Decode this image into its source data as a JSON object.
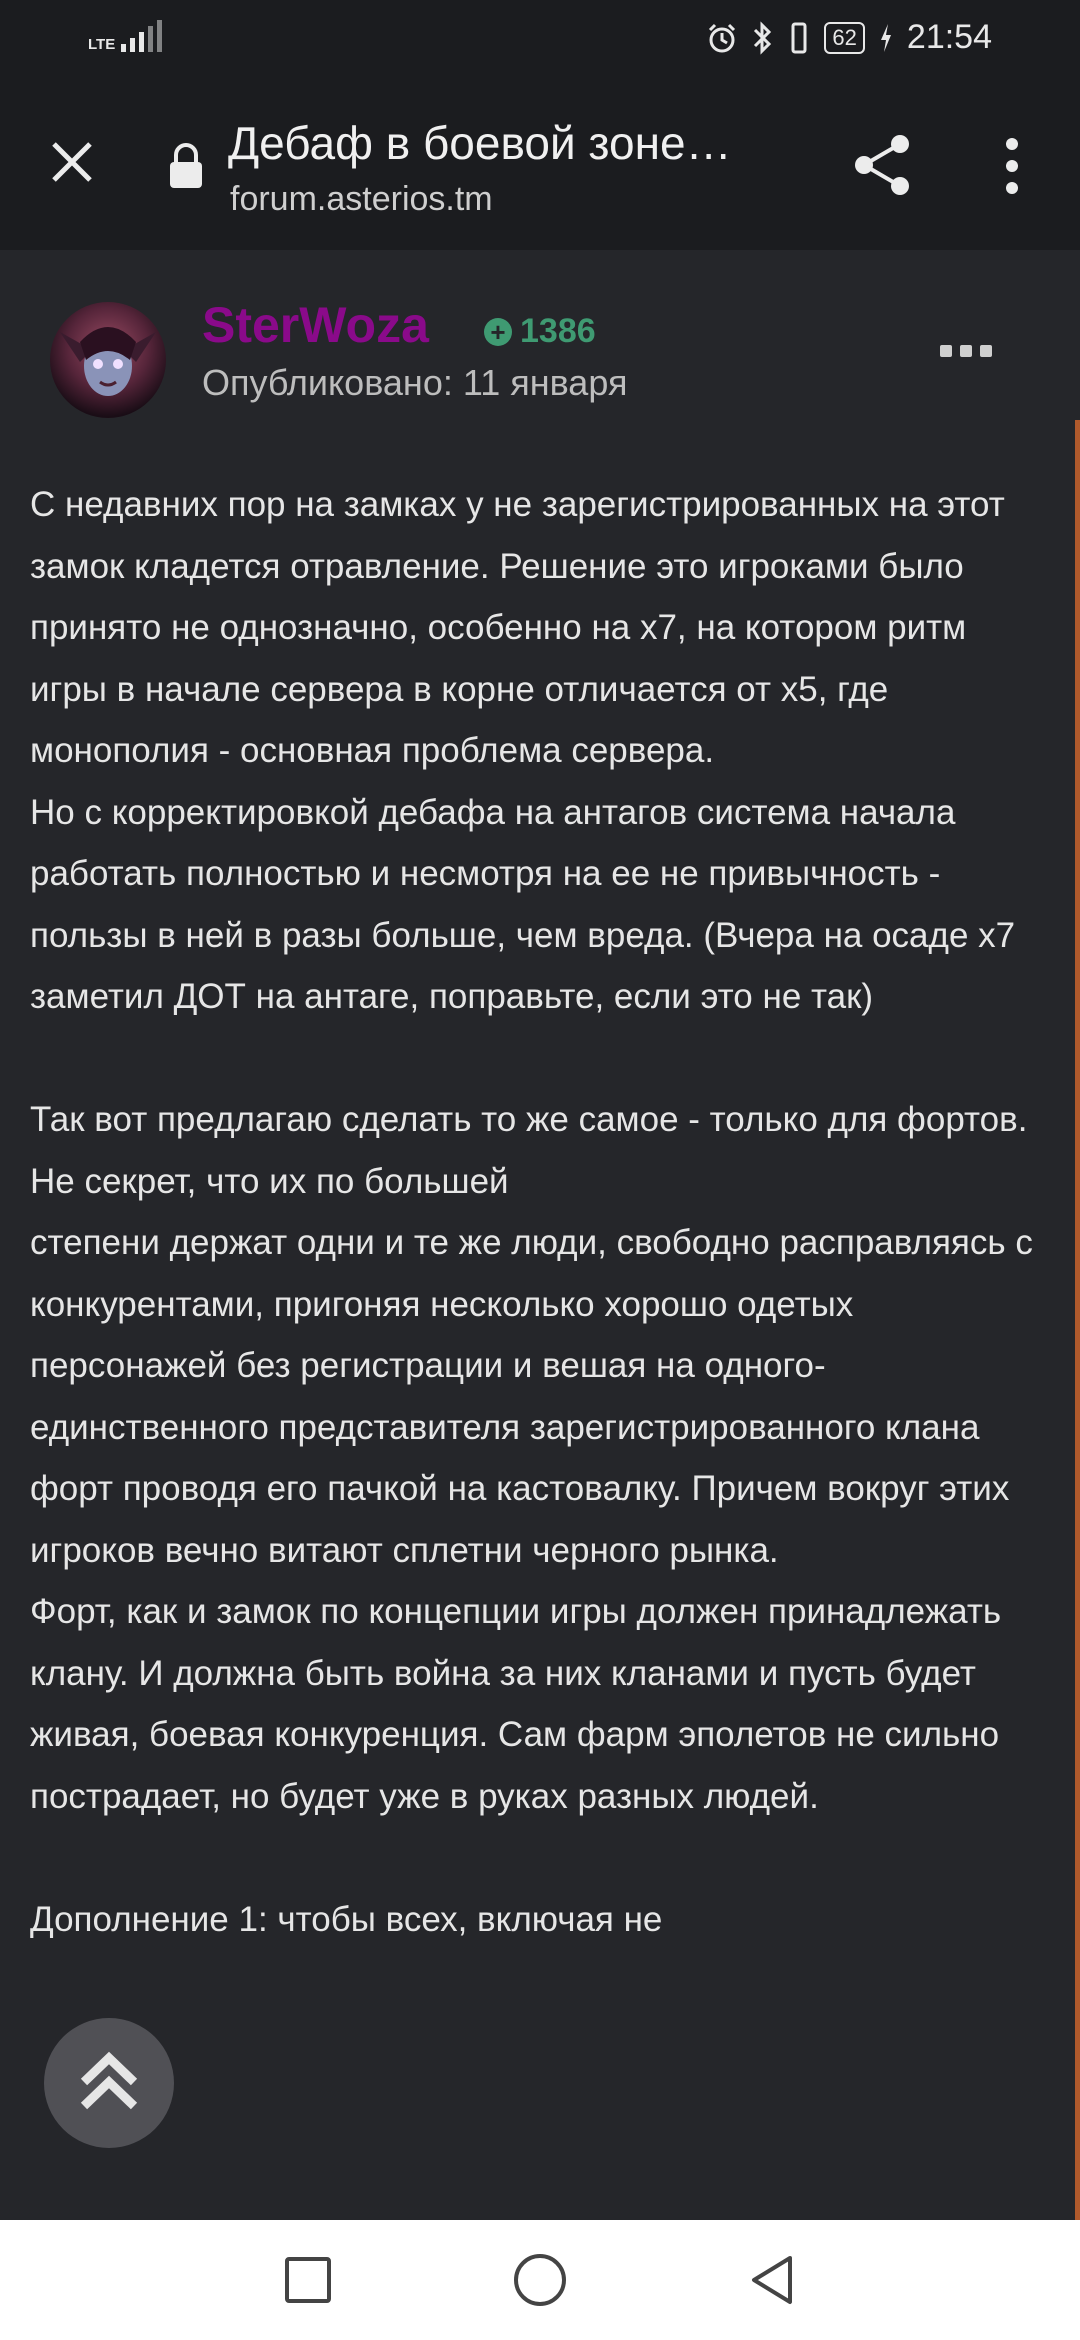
{
  "status_bar": {
    "network": "LTE",
    "battery": "62",
    "time": "21:54",
    "icons": [
      "signal-icon",
      "alarm-icon",
      "bluetooth-icon",
      "vibrate-icon",
      "battery-icon",
      "charging-icon"
    ]
  },
  "toolbar": {
    "title": "Дебаф в боевой зоне…",
    "url": "forum.asterios.tm",
    "icons": [
      "close-icon",
      "lock-icon",
      "share-icon",
      "more-vert-icon"
    ]
  },
  "post": {
    "author": "SterWoza",
    "reputation": "1386",
    "posted": "Опубликовано: 11 января",
    "colors": {
      "author": "#8a0a8a",
      "reputation": "#3f9a72",
      "accent_line": "#b05a2c"
    },
    "paragraphs": [
      "С недавних пор на замках у не зарегистрированных на этот замок кладется отравление. Решение это игроками было принято не однозначно, особенно на х7, на котором ритм игры в начале сервера в корне отличается от х5, где монополия - основная проблема сервера.",
      "Но с корректировкой дебафа на антагов система начала работать полностью и несмотря на ее не привычность - пользы в ней в разы больше, чем вреда. (Вчера на осаде х7 заметил ДОТ на антаге, поправьте, если это не так)",
      "",
      "Так вот предлагаю сделать то же самое - только для фортов. Не секрет, что их по большей",
      "степени держат одни и те же люди, свободно расправляясь с конкурентами, пригоняя несколько хорошо одетых персонажей без регистрации и вешая на одного-единственного представителя зарегистрированного клана форт проводя его пачкой на кастовалку. Причем вокруг этих игроков вечно витают сплетни черного рынка.",
      "Форт, как и замок по концепции игры должен принадлежать клану. И должна быть война за них кланами и пусть будет живая, боевая конкуренция. Сам фарм эполетов не сильно пострадает, но будет уже в руках разных людей.",
      "",
      "Дополнение 1: чтобы всех, включая не"
    ]
  },
  "nav": {
    "icons": [
      "recents-icon",
      "home-icon",
      "back-icon"
    ]
  }
}
